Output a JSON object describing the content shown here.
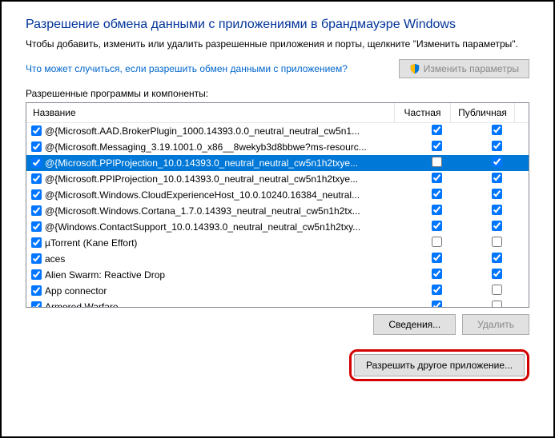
{
  "heading": "Разрешение обмена данными с приложениями в брандмауэре Windows",
  "description": "Чтобы добавить, изменить или удалить разрешенные приложения и порты, щелкните \"Изменить параметры\".",
  "risk_link": "Что может случиться, если разрешить обмен данными с приложением?",
  "change_params_btn": "Изменить параметры",
  "group_label": "Разрешенные программы и компоненты:",
  "columns": {
    "name": "Название",
    "private": "Частная",
    "public": "Публичная"
  },
  "rows": [
    {
      "name": "@{Microsoft.AAD.BrokerPlugin_1000.14393.0.0_neutral_neutral_cw5n1...",
      "enabled": true,
      "private": true,
      "public": true,
      "selected": false
    },
    {
      "name": "@{Microsoft.Messaging_3.19.1001.0_x86__8wekyb3d8bbwe?ms-resourc...",
      "enabled": true,
      "private": true,
      "public": true,
      "selected": false
    },
    {
      "name": "@{Microsoft.PPIProjection_10.0.14393.0_neutral_neutral_cw5n1h2txye...",
      "enabled": true,
      "private": false,
      "public": true,
      "selected": true
    },
    {
      "name": "@{Microsoft.PPIProjection_10.0.14393.0_neutral_neutral_cw5n1h2txye...",
      "enabled": true,
      "private": true,
      "public": true,
      "selected": false
    },
    {
      "name": "@{Microsoft.Windows.CloudExperienceHost_10.0.10240.16384_neutral...",
      "enabled": true,
      "private": true,
      "public": true,
      "selected": false
    },
    {
      "name": "@{Microsoft.Windows.Cortana_1.7.0.14393_neutral_neutral_cw5n1h2tx...",
      "enabled": true,
      "private": true,
      "public": true,
      "selected": false
    },
    {
      "name": "@{Windows.ContactSupport_10.0.14393.0_neutral_neutral_cw5n1h2txy...",
      "enabled": true,
      "private": true,
      "public": true,
      "selected": false
    },
    {
      "name": "µTorrent (Kane Effort)",
      "enabled": true,
      "private": false,
      "public": false,
      "selected": false
    },
    {
      "name": "aces",
      "enabled": true,
      "private": true,
      "public": true,
      "selected": false
    },
    {
      "name": "Alien Swarm: Reactive Drop",
      "enabled": true,
      "private": true,
      "public": true,
      "selected": false
    },
    {
      "name": "App connector",
      "enabled": true,
      "private": true,
      "public": false,
      "selected": false
    },
    {
      "name": "Armored Warfare",
      "enabled": true,
      "private": true,
      "public": false,
      "selected": false
    }
  ],
  "details_btn": "Сведения...",
  "remove_btn": "Удалить",
  "allow_another_btn": "Разрешить другое приложение..."
}
